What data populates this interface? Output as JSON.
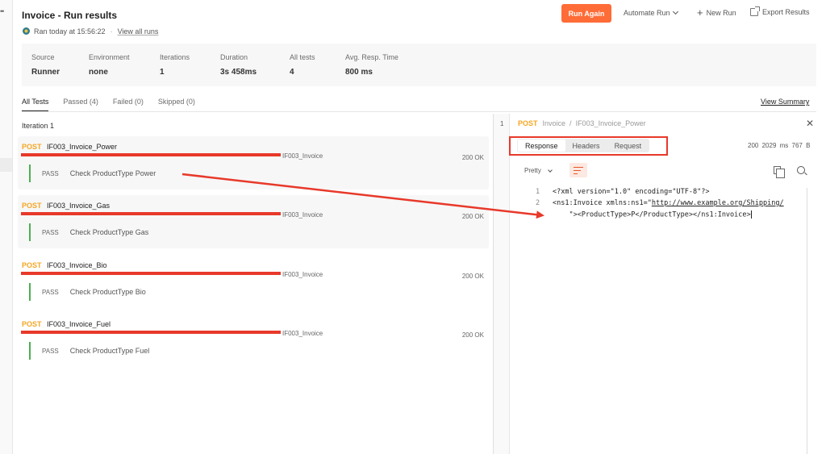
{
  "header": {
    "title": "Invoice - Run results",
    "ran_label": "Ran today at 15:56:22",
    "view_all_runs": "View all runs",
    "run_again": "Run Again",
    "automate_run": "Automate Run",
    "new_run": "New Run",
    "export_results": "Export Results"
  },
  "summary": {
    "stats": [
      {
        "label": "Source",
        "value": "Runner"
      },
      {
        "label": "Environment",
        "value": "none"
      },
      {
        "label": "Iterations",
        "value": "1"
      },
      {
        "label": "Duration",
        "value": "3s 458ms"
      },
      {
        "label": "All tests",
        "value": "4"
      },
      {
        "label": "Avg. Resp. Time",
        "value": "800 ms"
      }
    ]
  },
  "tabs": {
    "items": [
      "All Tests",
      "Passed (4)",
      "Failed (0)",
      "Skipped (0)"
    ],
    "view_summary": "View Summary"
  },
  "iteration": {
    "label": "Iteration 1"
  },
  "requests": [
    {
      "method": "POST",
      "name": "IF003_Invoice_Power",
      "url_tail": "IF003_Invoice",
      "status": "200 OK",
      "pass": "PASS",
      "test": "Check ProductType Power"
    },
    {
      "method": "POST",
      "name": "IF003_Invoice_Gas",
      "url_tail": "IF003_Invoice",
      "status": "200 OK",
      "pass": "PASS",
      "test": "Check ProductType Gas"
    },
    {
      "method": "POST",
      "name": "IF003_Invoice_Bio",
      "url_tail": "IF003_Invoice",
      "status": "200 OK",
      "pass": "PASS",
      "test": "Check ProductType Bio"
    },
    {
      "method": "POST",
      "name": "IF003_Invoice_Fuel",
      "url_tail": "IF003_Invoice",
      "status": "200 OK",
      "pass": "PASS",
      "test": "Check ProductType Fuel"
    }
  ],
  "response": {
    "row_num": "1",
    "method": "POST",
    "crumb_collection": "Invoice",
    "crumb_sep": "/",
    "crumb_request": "IF003_Invoice_Power",
    "tabs": [
      "Response",
      "Headers",
      "Request"
    ],
    "status_code": "200",
    "time": "2029 ms",
    "size": "767 B",
    "format": "Pretty",
    "code": {
      "line_numbers": [
        "1",
        "2"
      ],
      "line1": "<?xml version=\"1.0\" encoding=\"UTF-8\"?>",
      "line2_pre": "<ns1:Invoice xmlns:ns1=\"",
      "line2_url": "http://www.example.org/Shipping/",
      "line3": "    \"><ProductType>P</ProductType></ns1:Invoice>"
    }
  },
  "colors": {
    "accent": "#ff6c37",
    "method_post": "#f5a623",
    "pass_bar": "#4caf50",
    "annotation_red": "#e8392a"
  }
}
